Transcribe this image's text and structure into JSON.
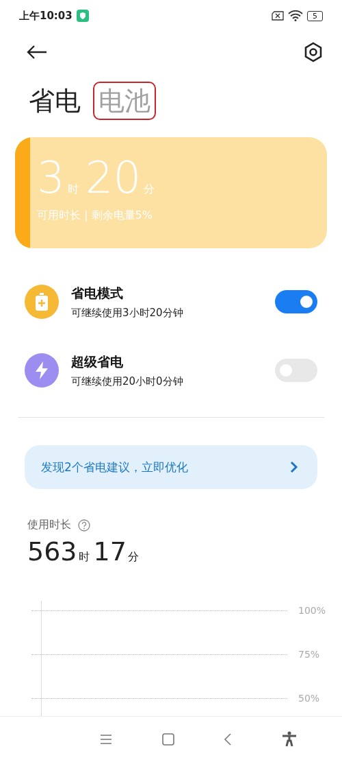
{
  "status_bar": {
    "time": "上午10:03",
    "battery": "5"
  },
  "tabs": [
    {
      "label": "省电",
      "selected": true,
      "annotated": false
    },
    {
      "label": "电池",
      "selected": false,
      "annotated": true
    }
  ],
  "summary": {
    "hours": "3",
    "hours_unit": "时",
    "minutes": "20",
    "minutes_unit": "分",
    "caption": "可用时长 | 剩余电量5%"
  },
  "modes": [
    {
      "kind": "battery",
      "color": "#f5b935",
      "title": "省电模式",
      "subtitle": "可继续使用3小时20分钟",
      "on": true
    },
    {
      "kind": "bolt",
      "color": "#9b8ef0",
      "title": "超级省电",
      "subtitle": "可继续使用20小时0分钟",
      "on": false
    }
  ],
  "suggestion": {
    "text": "发现2个省电建议，立即优化"
  },
  "usage": {
    "label": "使用时长",
    "hours": "563",
    "hours_unit": "时",
    "minutes": "17",
    "minutes_unit": "分"
  },
  "chart": {
    "ticks": [
      "100%",
      "75%",
      "50%"
    ]
  }
}
